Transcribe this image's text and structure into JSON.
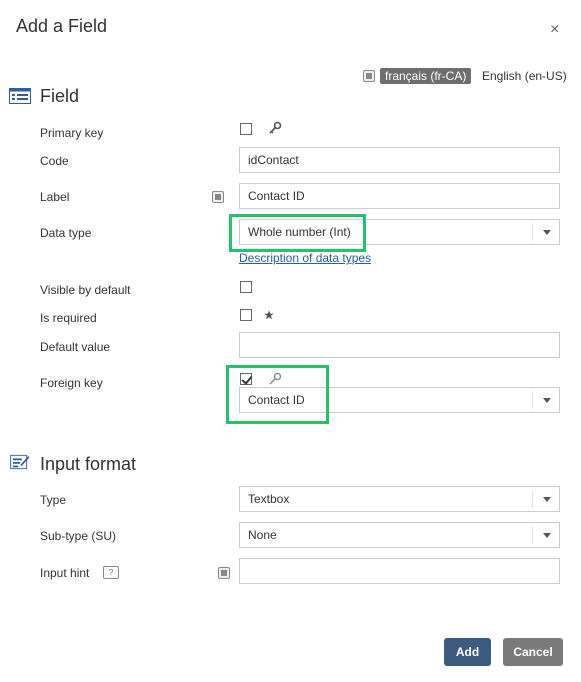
{
  "dialog": {
    "title": "Add a Field",
    "close_glyph": "×"
  },
  "languages": {
    "active": "français (fr-CA)",
    "other": "English (en-US)"
  },
  "field_section": {
    "heading": "Field",
    "primary_key": {
      "label": "Primary key",
      "checked": false
    },
    "code": {
      "label": "Code",
      "value": "idContact"
    },
    "label": {
      "label": "Label",
      "value": "Contact ID"
    },
    "data_type": {
      "label": "Data type",
      "value": "Whole number (Int)",
      "link": "Description of data types"
    },
    "visible_by_default": {
      "label": "Visible by default",
      "checked": false
    },
    "is_required": {
      "label": "Is required",
      "checked": false
    },
    "default_value": {
      "label": "Default value",
      "value": ""
    },
    "foreign_key": {
      "label": "Foreign key",
      "checked": true,
      "value": "Contact ID"
    }
  },
  "input_format": {
    "heading": "Input format",
    "type": {
      "label": "Type",
      "value": "Textbox"
    },
    "sub_type": {
      "label": "Sub-type (SU)",
      "value": "None"
    },
    "input_hint": {
      "label": "Input hint",
      "hint_glyph": "?",
      "value": ""
    }
  },
  "buttons": {
    "add": "Add",
    "cancel": "Cancel"
  },
  "colors": {
    "highlight": "#23c36a",
    "primary_button": "#3c5b7f",
    "secondary_button": "#7a7a7a",
    "link": "#2a5ea8"
  }
}
